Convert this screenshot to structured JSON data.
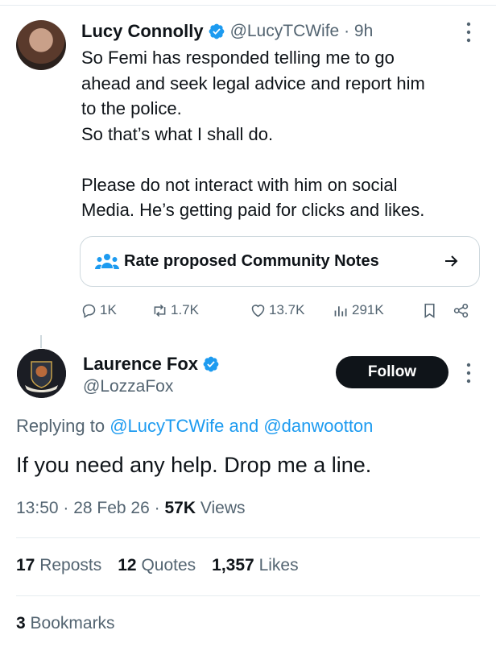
{
  "colors": {
    "text": "#0f1419",
    "secondary": "#536471",
    "link": "#1d9bf0",
    "verified": "#1d9bf0",
    "border": "#cfd9de"
  },
  "tweet1": {
    "name": "Lucy Connolly",
    "handle_time": "@LucyTCWife · 9h",
    "lines": [
      "So Femi has responded telling me to go",
      "ahead and seek legal advice and report him",
      "to the police.",
      "So that’s what I shall do.",
      "",
      "Please do not interact with him on social",
      "Media. He’s getting paid for clicks and likes."
    ],
    "community_notes_label": "Rate proposed Community Notes",
    "actions": {
      "replies": "1K",
      "reposts": "1.7K",
      "likes": "13.7K",
      "views": "291K"
    }
  },
  "tweet2": {
    "name": "Laurence Fox",
    "handle": "@LozzaFox",
    "follow_label": "Follow",
    "replying_prefix": "Replying to",
    "replying_user1": "@LucyTCWife",
    "replying_and": "and",
    "replying_user2": "@danwootton",
    "text": "If you need any help. Drop me a line.",
    "time": "13:50 · 28 Feb 26 ·",
    "views_count": "57K",
    "views_label": "Views",
    "reposts_count": "17",
    "reposts_label": "Reposts",
    "quotes_count": "12",
    "quotes_label": "Quotes",
    "likes_count": "1,357",
    "likes_label": "Likes",
    "bookmarks_count": "3",
    "bookmarks_label": "Bookmarks"
  },
  "icons": [
    "verified-badge-icon",
    "more-options-icon",
    "community-notes-icon",
    "arrow-right-icon",
    "reply-icon",
    "repost-icon",
    "like-icon",
    "views-icon",
    "bookmark-icon",
    "share-icon"
  ]
}
